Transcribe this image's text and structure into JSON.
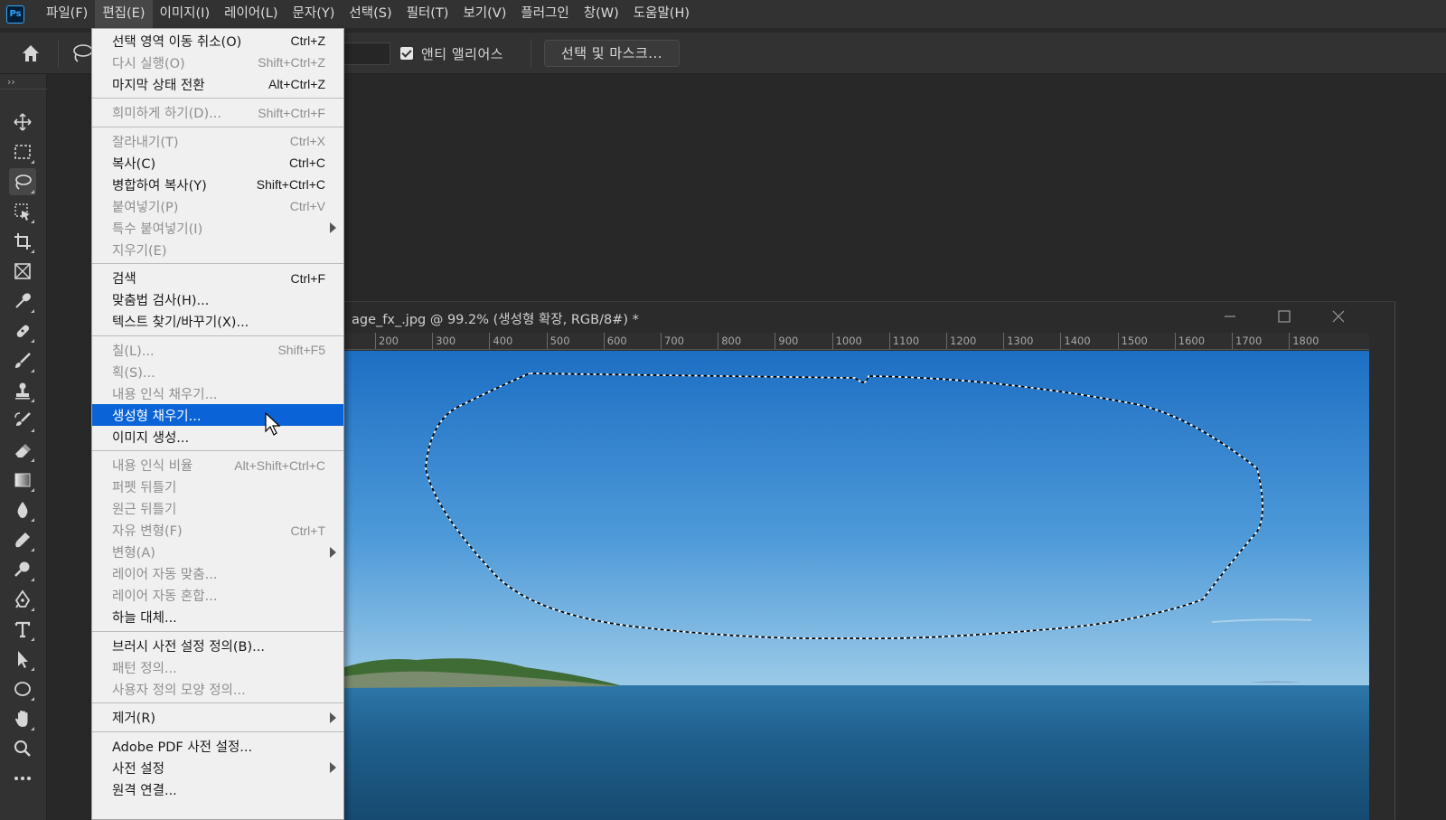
{
  "menubar": {
    "items": [
      {
        "label": "파일(F)"
      },
      {
        "label": "편집(E)"
      },
      {
        "label": "이미지(I)"
      },
      {
        "label": "레이어(L)"
      },
      {
        "label": "문자(Y)"
      },
      {
        "label": "선택(S)"
      },
      {
        "label": "필터(T)"
      },
      {
        "label": "보기(V)"
      },
      {
        "label": "플러그인"
      },
      {
        "label": "창(W)"
      },
      {
        "label": "도움말(H)"
      }
    ]
  },
  "app": {
    "logo": "Ps"
  },
  "options": {
    "anti_alias_label": "앤티 앨리어스",
    "anti_alias_checked": true,
    "mask_button": "선택 및 마스크..."
  },
  "toolbar": {
    "collapse_glyph": "››",
    "selected": "lasso-tool",
    "tools": [
      "move-tool",
      "marquee-tool",
      "lasso-tool",
      "object-select-tool",
      "crop-tool",
      "frame-tool",
      "eyedropper-tool",
      "healing-tool",
      "brush-tool",
      "stamp-tool",
      "history-brush-tool",
      "eraser-tool",
      "gradient-tool",
      "blur-tool",
      "dodge-tool",
      "burn-tool",
      "pen-tool",
      "type-tool",
      "path-select-tool",
      "ellipse-tool",
      "hand-tool",
      "zoom-tool",
      "more-tools"
    ]
  },
  "document": {
    "title": "age_fx_.jpg @ 99.2% (생성형 확장, RGB/8#) *",
    "ruler_labels": [
      "200",
      "300",
      "400",
      "500",
      "600",
      "700",
      "800",
      "900",
      "1000",
      "1100",
      "1200",
      "1300",
      "1400",
      "1500",
      "1600",
      "1700",
      "1800"
    ],
    "colors": {
      "sky_top": "#1d6fc4",
      "sky_bottom": "#9ccbe8",
      "sea": "#1f5f8d"
    }
  },
  "edit_menu": {
    "items": [
      {
        "label": "선택 영역 이동 취소(O)",
        "shortcut": "Ctrl+Z",
        "enabled": true
      },
      {
        "label": "다시 실행(O)",
        "shortcut": "Shift+Ctrl+Z",
        "enabled": false
      },
      {
        "label": "마지막 상태 전환",
        "shortcut": "Alt+Ctrl+Z",
        "enabled": true
      },
      {
        "label": "희미하게 하기(D)...",
        "shortcut": "Shift+Ctrl+F",
        "enabled": false
      },
      {
        "label": "잘라내기(T)",
        "shortcut": "Ctrl+X",
        "enabled": false
      },
      {
        "label": "복사(C)",
        "shortcut": "Ctrl+C",
        "enabled": true
      },
      {
        "label": "병합하여 복사(Y)",
        "shortcut": "Shift+Ctrl+C",
        "enabled": true
      },
      {
        "label": "붙여넣기(P)",
        "shortcut": "Ctrl+V",
        "enabled": false
      },
      {
        "label": "특수 붙여넣기(I)",
        "shortcut": "",
        "enabled": false,
        "submenu": true
      },
      {
        "label": "지우기(E)",
        "shortcut": "",
        "enabled": false
      },
      {
        "label": "검색",
        "shortcut": "Ctrl+F",
        "enabled": true
      },
      {
        "label": "맞춤법 검사(H)...",
        "shortcut": "",
        "enabled": true
      },
      {
        "label": "텍스트 찾기/바꾸기(X)...",
        "shortcut": "",
        "enabled": true
      },
      {
        "label": "칠(L)...",
        "shortcut": "Shift+F5",
        "enabled": false
      },
      {
        "label": "획(S)...",
        "shortcut": "",
        "enabled": false
      },
      {
        "label": "내용 인식 채우기...",
        "shortcut": "",
        "enabled": false
      },
      {
        "label": "생성형 채우기...",
        "shortcut": "",
        "enabled": true,
        "highlighted": true
      },
      {
        "label": "이미지 생성...",
        "shortcut": "",
        "enabled": true
      },
      {
        "label": "내용 인식 비율",
        "shortcut": "Alt+Shift+Ctrl+C",
        "enabled": false
      },
      {
        "label": "퍼펫 뒤틀기",
        "shortcut": "",
        "enabled": false
      },
      {
        "label": "원근 뒤틀기",
        "shortcut": "",
        "enabled": false
      },
      {
        "label": "자유 변형(F)",
        "shortcut": "Ctrl+T",
        "enabled": false
      },
      {
        "label": "변형(A)",
        "shortcut": "",
        "enabled": false,
        "submenu": true
      },
      {
        "label": "레이어 자동 맞춤...",
        "shortcut": "",
        "enabled": false
      },
      {
        "label": "레이어 자동 혼합...",
        "shortcut": "",
        "enabled": false
      },
      {
        "label": "하늘 대체...",
        "shortcut": "",
        "enabled": true
      },
      {
        "label": "브러시 사전 설정 정의(B)...",
        "shortcut": "",
        "enabled": true
      },
      {
        "label": "패턴 정의...",
        "shortcut": "",
        "enabled": false
      },
      {
        "label": "사용자 정의 모양 정의...",
        "shortcut": "",
        "enabled": false
      },
      {
        "label": "제거(R)",
        "shortcut": "",
        "enabled": true,
        "submenu": true
      },
      {
        "label": "Adobe PDF 사전 설정...",
        "shortcut": "",
        "enabled": true
      },
      {
        "label": "사전 설정",
        "shortcut": "",
        "enabled": true,
        "submenu": true
      },
      {
        "label": "원격 연결...",
        "shortcut": "",
        "enabled": true
      }
    ]
  }
}
